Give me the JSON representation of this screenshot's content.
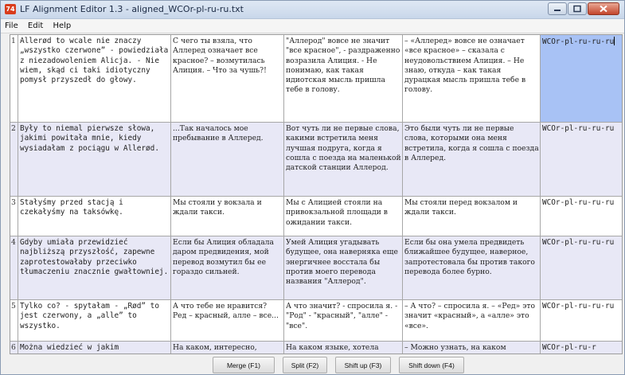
{
  "window": {
    "app_icon": "74",
    "title": "LF Alignment Editor 1.3 - aligned_WCOr-pl-ru-ru.txt",
    "controls": [
      "minimize-icon",
      "maximize-icon",
      "close-icon"
    ]
  },
  "menu": [
    "File",
    "Edit",
    "Help"
  ],
  "rows": [
    {
      "index": "1",
      "pl": "Allerød to wcale nie znaczy „wszystko czerwone” - powiedziała z niezadowoleniem Alicja. - Nie wiem, skąd ci taki idiotyczny pomysł przyszedł do głowy.",
      "ru1": "С чего ты взяла, что Аллеред означает все красное? – возмутилась Алиция. – Что за чушь?!",
      "ru2": "\"Аллерод\" вовсе не значит \"все красное\", - раздраженно возразила Алиция. - Не понимаю, как такая идиотская мысль пришла тебе в голову.",
      "ru3": "– «Аллеред» вовсе не означает «все красное» – сказала с неудовольствием Алиция. – Не знаю, откуда – как такая дурацкая мысль пришла тебе в голову.",
      "file": "WCOr-pl-ru-ru-ru"
    },
    {
      "index": "2",
      "pl": "Były to niemal pierwsze słowa, jakimi powitała mnie, kiedy wysiadałam z pociągu w Allerød.",
      "ru1": "...Так началось мое пребывание в Аллеред.",
      "ru2": "Вот чуть ли не первые слова, какими встретила меня лучшая подруга, когда я сошла с поезда на маленькой датской станции Аллерод.",
      "ru3": "Это были чуть ли не первые слова, которыми она меня встретила, когда я сошла с поезда в Аллеред.",
      "file": "WCOr-pl-ru-ru-ru"
    },
    {
      "index": "3",
      "pl": "Stałyśmy przed stacją i czekałyśmy na taksówkę.",
      "ru1": "Мы стояли у вокзала и ждали такси.",
      "ru2": "Мы с Алицией стояли на привокзальной площади в ожидании такси.",
      "ru3": "Мы стояли перед вокзалом и ждали такси.",
      "file": "WCOr-pl-ru-ru-ru"
    },
    {
      "index": "4",
      "pl": "Gdyby umiała przewidzieć najbliższą przyszłość, zapewne zaprotestowałaby przeciwko tłumaczeniu znacznie gwałtowniej.",
      "ru1": "Если бы Алиция обладала даром предвидения, мой перевод возмутил бы ее гораздо сильней.",
      "ru2": "Умей Алиция угадывать будущее, она наверняка еще энергичнее восстала бы против моего перевода названия \"Аллерод\".",
      "ru3": "Если бы она умела предвидеть ближайшее будущее, наверное, запротестовала бы против такого перевода более бурно.",
      "file": "WCOr-pl-ru-ru-ru"
    },
    {
      "index": "5",
      "pl": "Tylko co? - spytałam - „Rød” to jest czerwony, a „alle” to wszystko.",
      "ru1": "А что тебе не нравится? Ред – красный, алле – все...",
      "ru2": "А что значит? - спросила я. - \"Род\" - \"красный\", \"алле\" - \"все\".",
      "ru3": "– А что? – спросила я. – «Ред» это значит «красный», а «алле» это «все».",
      "file": "WCOr-pl-ru-ru-ru"
    },
    {
      "index": "6",
      "pl": "Można wiedzieć w jakim",
      "ru1": "На каком, интересно,",
      "ru2": "На каком языке, хотела",
      "ru3": "– Можно узнать, на каком",
      "file": "WCOr-pl-ru-r"
    }
  ],
  "buttons": {
    "merge": "Merge (F1)",
    "split": "Split (F2)",
    "shift_up": "Shift up (F3)",
    "shift_down": "Shift down (F4)"
  },
  "colors": {
    "selected_cell": "#a8c2f5",
    "alt_row": "#e8e8f6"
  }
}
